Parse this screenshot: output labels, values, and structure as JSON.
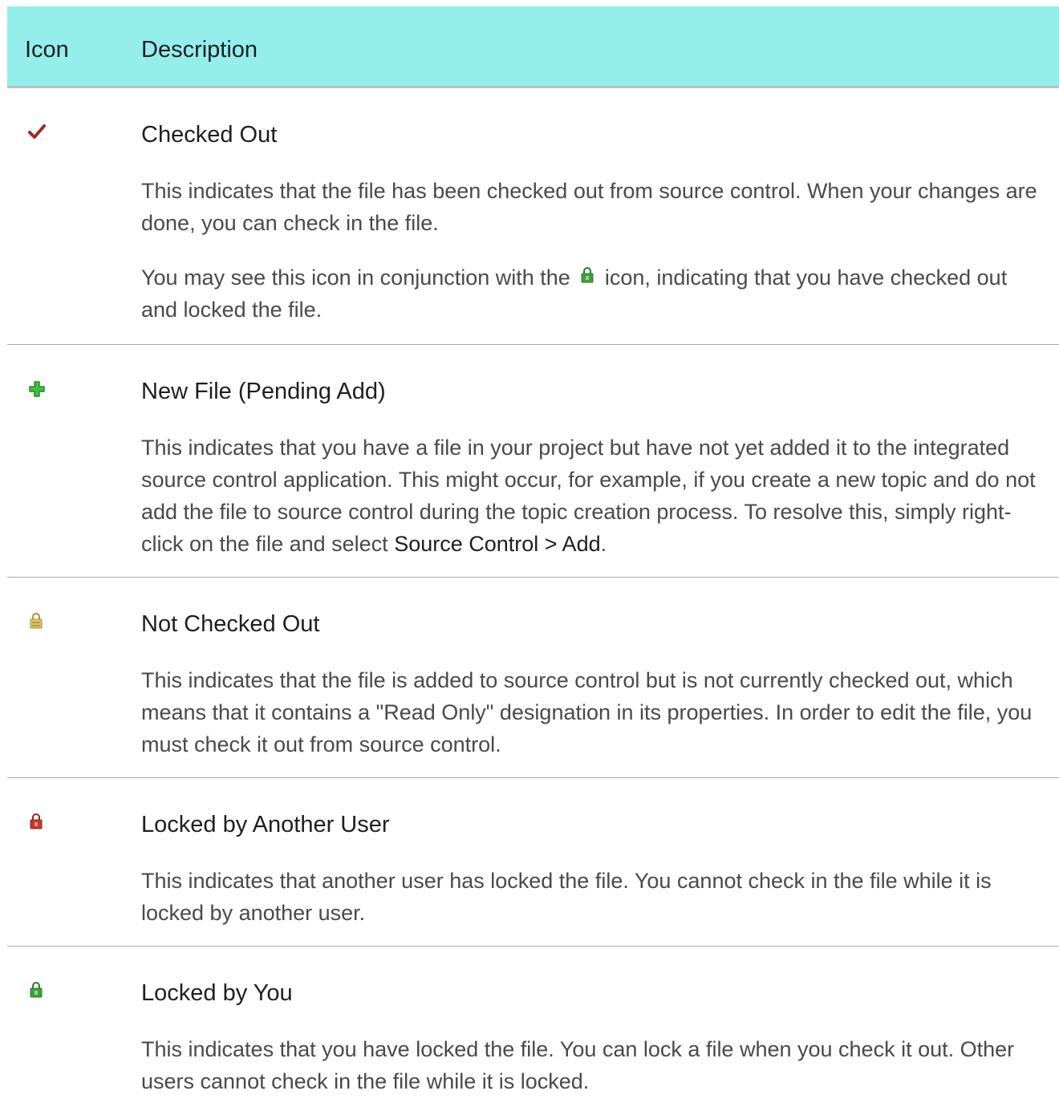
{
  "header": {
    "icon_col": "Icon",
    "description_col": "Description"
  },
  "rows": [
    {
      "icon": "checkmark-icon",
      "icon_color": "#9b2a2a",
      "title": "Checked Out",
      "para1": "This indicates that the file has been checked out from source control. When your changes are done, you can check in the file.",
      "para2_before": "You may see this icon in conjunction with the",
      "para2_after": "icon, indicating that you have checked out and locked the file."
    },
    {
      "icon": "plus-icon",
      "icon_color": "#3fbf3f",
      "title": "New File (Pending Add)",
      "para1_before": "This indicates that you have a file in your project but have not yet added it to the integrated source control application. This might occur, for example, if you create a new topic and do not add the file to source control during the topic creation process. To resolve this, simply right-click on the file and select",
      "para1_menu": "Source Control > Add",
      "para1_after": "."
    },
    {
      "icon": "lock-yellow-icon",
      "icon_color": "#e0c36a",
      "title": "Not Checked Out",
      "para1": "This indicates that the file is added to source control but is not currently checked out, which means that it contains a \"Read Only\" designation in its properties. In order to edit the file, you must check it out from source control."
    },
    {
      "icon": "lock-red-icon",
      "icon_color": "#c0392b",
      "title": "Locked by Another User",
      "para1": "This indicates that another user has locked the file. You cannot check in the file while it is locked by another user."
    },
    {
      "icon": "lock-green-icon",
      "icon_color": "#3f9f3f",
      "title": "Locked by You",
      "para1": "This indicates that you have locked the file. You can lock a file when you check it out. Other users cannot check in the file while it is locked."
    }
  ]
}
